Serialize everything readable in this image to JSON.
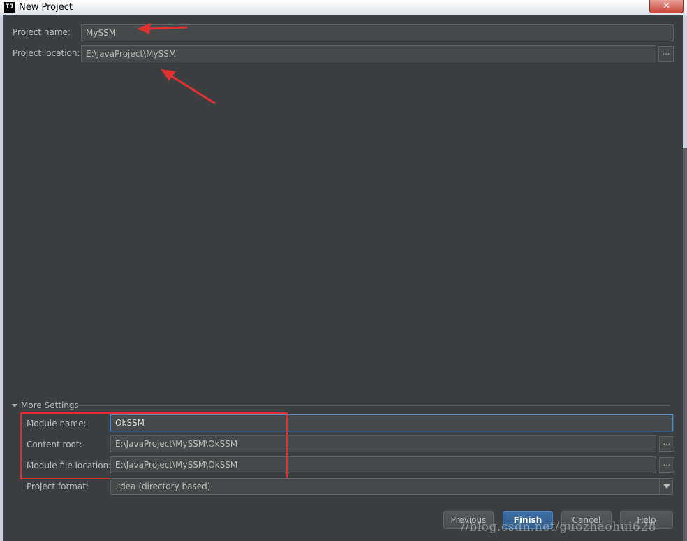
{
  "window": {
    "title": "New Project",
    "app_icon": "IJ",
    "close_glyph": "✕"
  },
  "project": {
    "name_label": "Project name:",
    "name_value": "MySSM",
    "location_label": "Project location:",
    "location_value": "E:\\JavaProject\\MySSM"
  },
  "more_settings": {
    "header": "More Settings",
    "module_name_label": "Module name:",
    "module_name_value": "OkSSM",
    "content_root_label": "Content root:",
    "content_root_value": "E:\\JavaProject\\MySSM\\OkSSM",
    "module_file_label": "Module file location:",
    "module_file_value": "E:\\JavaProject\\MySSM\\OkSSM",
    "format_label": "Project format:",
    "format_value": ".idea (directory based)"
  },
  "browse_glyph": "...",
  "buttons": {
    "previous": "Previous",
    "finish": "Finish",
    "cancel": "Cancel",
    "help": "Help"
  },
  "watermark": "//blog.csdn.net/guozhaohui628",
  "colors": {
    "background": "#3c3f41",
    "annotation": "#e03030",
    "focus": "#4a88c7"
  },
  "icons": {
    "triangle": "expand-triangle-icon",
    "dropdown": "chevron-down-icon",
    "arrow": "annotation-arrow-icon"
  }
}
